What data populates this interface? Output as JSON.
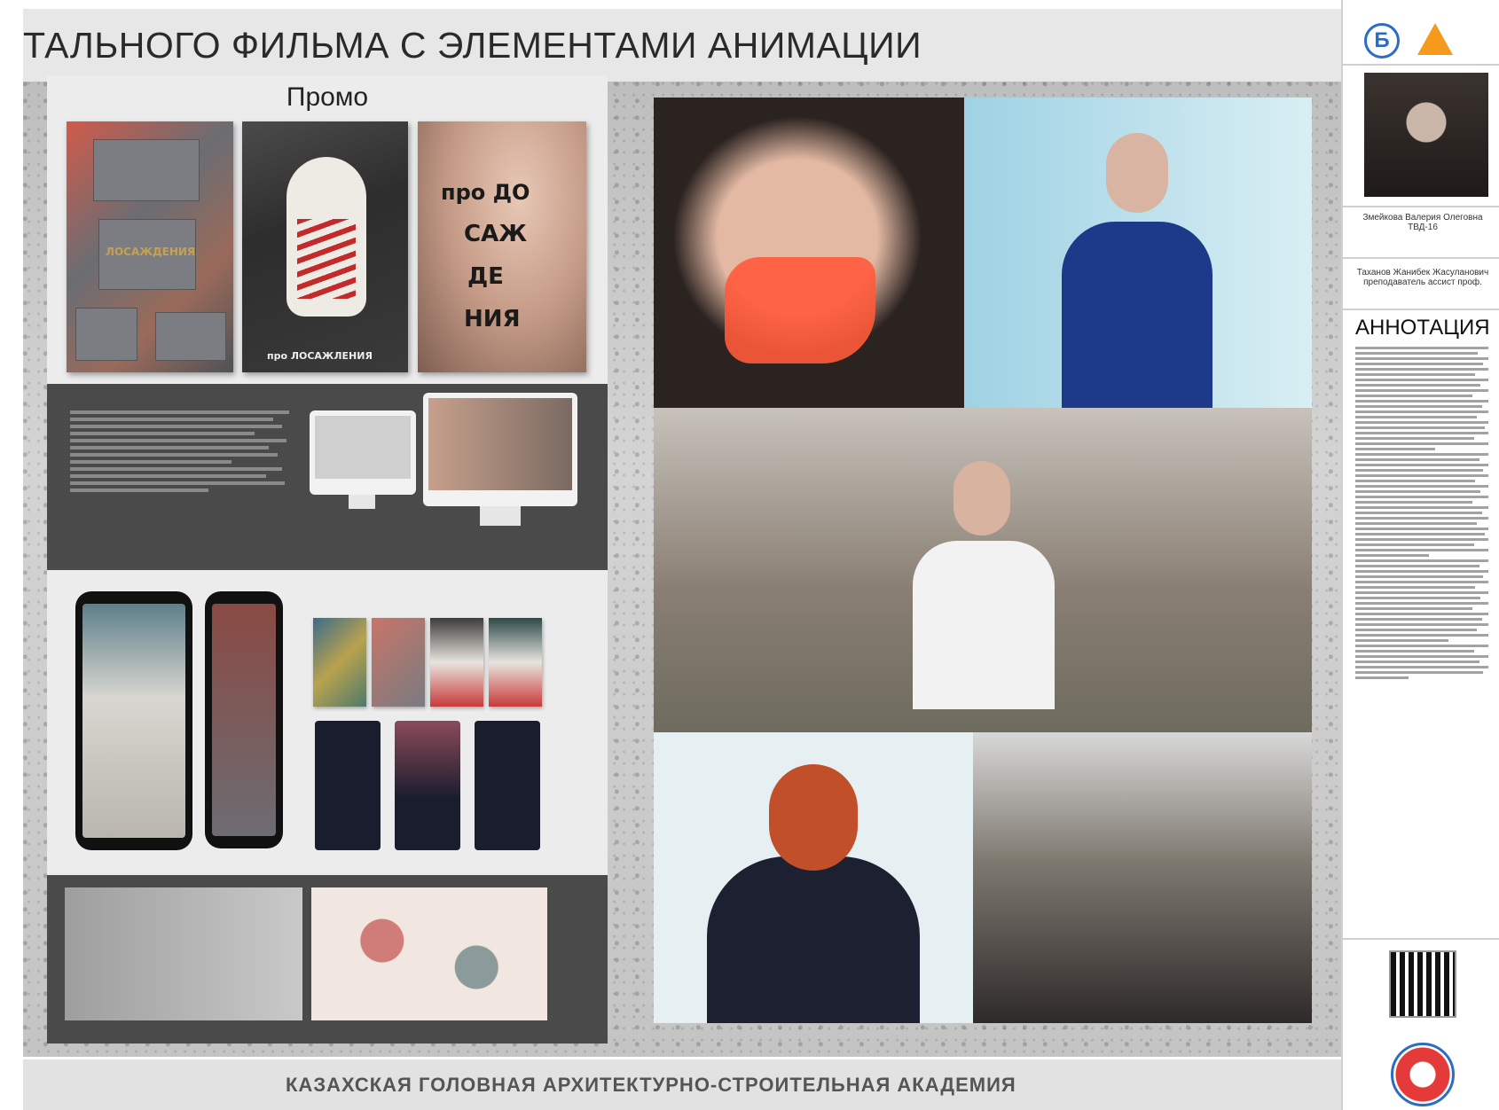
{
  "header": {
    "title": "ТАЛЬНОГО ФИЛЬМА С ЭЛЕМЕНТАМИ АНИМАЦИИ"
  },
  "promo": {
    "title": "Промо",
    "poster1_word": "ЛОСАЖДЕНИЯ",
    "poster2_word": "про ЛОСАЖЛЕНИЯ",
    "poster3_lines": [
      "про ДО",
      "САЖ",
      "ДЕ",
      "НИЯ"
    ]
  },
  "sidebar": {
    "badge": "Б",
    "student": "Змейкова Валерия Олеговна ТВД-16",
    "advisor": "Таханов Жанибек Жасуланович преподаватель ассист проф.",
    "annotation_title": "АННОТАЦИЯ"
  },
  "footer": {
    "title": "КАЗАХСКАЯ ГОЛОВНАЯ АРХИТЕКТУРНО-СТРОИТЕЛЬНАЯ АКАДЕМИЯ"
  },
  "colors": {
    "accent_blue": "#2b6cc4",
    "accent_orange": "#f59a1d",
    "panel_dark": "#4a4a4a"
  }
}
